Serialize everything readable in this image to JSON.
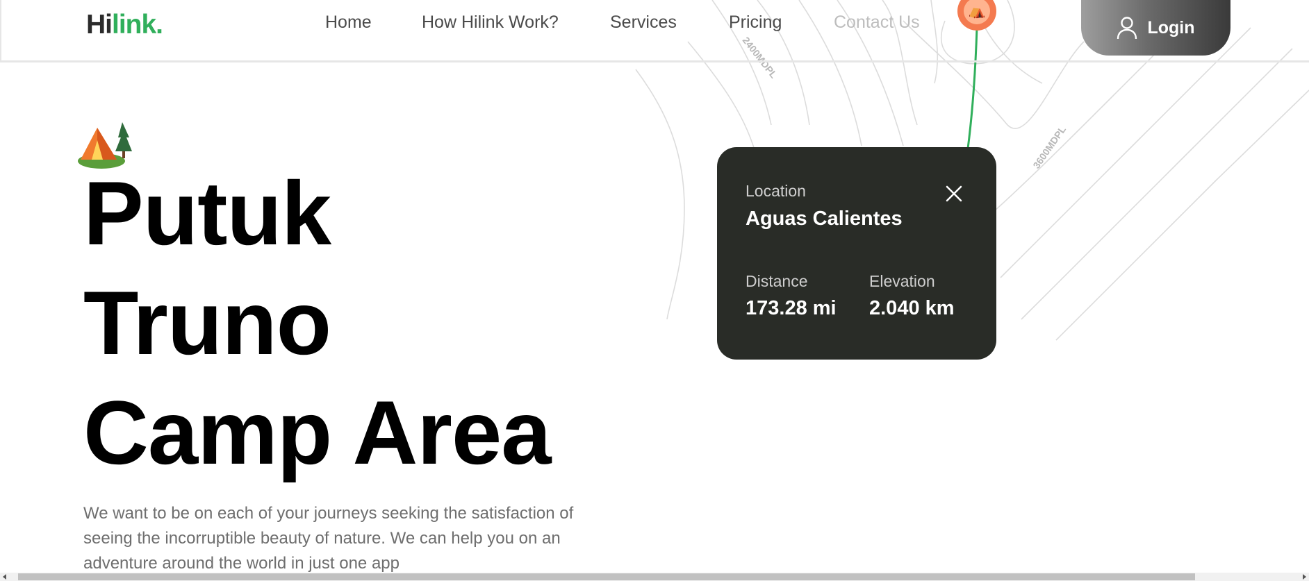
{
  "brand": {
    "logo_part1": "Hi",
    "logo_part2": "link.",
    "accent_color": "#30af5b"
  },
  "nav": {
    "items": [
      {
        "label": "Home"
      },
      {
        "label": "How Hilink Work?"
      },
      {
        "label": "Services"
      },
      {
        "label": "Pricing"
      },
      {
        "label": "Contact Us"
      }
    ]
  },
  "login": {
    "label": "Login",
    "icon": "user-icon"
  },
  "map": {
    "contour_labels": [
      "2400MDPL",
      "3600MDPL"
    ],
    "pin_icon": "tent-icon",
    "route_color": "#30af5b",
    "pin_color": "#f47a4f"
  },
  "hero": {
    "icon": "camp-icon",
    "title_line1": "Putuk",
    "title_line2": "Truno",
    "title_line3": "Camp Area",
    "description": "We want to be on each of your journeys seeking the satisfaction of seeing the incorruptible beauty of nature. We can help you on an adventure around the world in just one app"
  },
  "location_card": {
    "location_label": "Location",
    "location_value": "Aguas Calientes",
    "distance_label": "Distance",
    "distance_value": "173.28 mi",
    "elevation_label": "Elevation",
    "elevation_value": "2.040 km",
    "close_icon": "close-icon",
    "background_color": "#292c27"
  }
}
